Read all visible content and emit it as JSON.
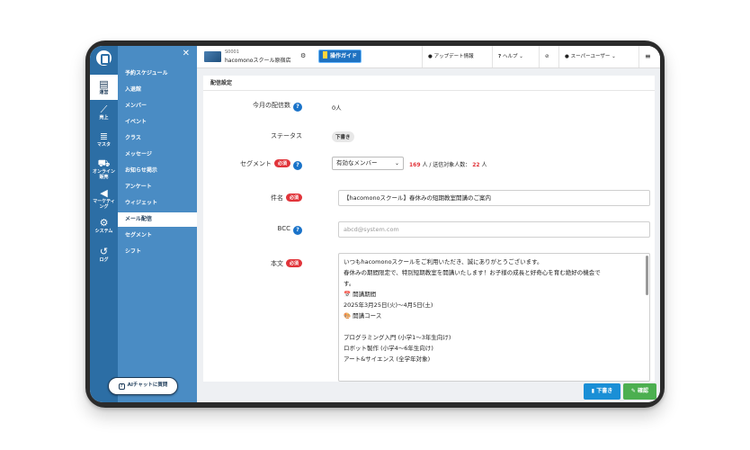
{
  "rail": [
    {
      "icon": "store-icon",
      "glyph": "▤",
      "label": "運営",
      "active": true
    },
    {
      "icon": "sales-chart-icon",
      "glyph": "⟋",
      "label": "売上",
      "active": false
    },
    {
      "icon": "database-icon",
      "glyph": "≣",
      "label": "マスタ",
      "active": false
    },
    {
      "icon": "cart-icon",
      "glyph": "⛟",
      "label": "オンライン販売",
      "active": false
    },
    {
      "icon": "megaphone-icon",
      "glyph": "◀",
      "label": "マーケティング",
      "active": false
    },
    {
      "icon": "gear-icon",
      "glyph": "⚙",
      "label": "システム",
      "active": false
    },
    {
      "icon": "history-icon",
      "glyph": "↺",
      "label": "ログ",
      "active": false
    }
  ],
  "menu": {
    "items": [
      {
        "label": "予約スケジュール",
        "active": false
      },
      {
        "label": "入退館",
        "active": false
      },
      {
        "label": "メンバー",
        "active": false
      },
      {
        "label": "イベント",
        "active": false
      },
      {
        "label": "クラス",
        "active": false
      },
      {
        "label": "メッセージ",
        "active": false
      },
      {
        "label": "お知らせ掲示",
        "active": false
      },
      {
        "label": "アンケート",
        "active": false
      },
      {
        "label": "ウィジェット",
        "active": false
      },
      {
        "label": "メール配信",
        "active": true
      },
      {
        "label": "セグメント",
        "active": false
      },
      {
        "label": "シフト",
        "active": false
      }
    ],
    "ai_button": "AIチャットに質問"
  },
  "topbar": {
    "store_code": "S0001",
    "store_name": "hacomonoスクール原宿店",
    "guide_label": "操作ガイド",
    "update_info": "アップデート情報",
    "help": "ヘルプ",
    "user": "スーパーユーザー"
  },
  "form": {
    "section_title": "配信設定",
    "monthly_count_label": "今月の配信数",
    "monthly_count_value": "0人",
    "status_label": "ステータス",
    "status_value": "下書き",
    "segment_label": "セグメント",
    "required": "必須",
    "segment_value": "有効なメンバー",
    "segment_count": "169",
    "segment_text": "人 / 送信対象人数：",
    "target_count": "22",
    "target_unit": "人",
    "subject_label": "件名",
    "subject_value": "【hacomonoスクール】春休みの短期教室開講のご案内",
    "bcc_label": "BCC",
    "bcc_placeholder": "abcd@system.com",
    "body_label": "本文",
    "body_lines": [
      "いつもhacomonoスクールをご利用いただき、誠にありがとうございます。",
      "春休みの期間限定で、特別短期教室を開講いたします！お子様の成長と好奇心を育む絶好の機会で",
      "す。",
      "📅 開講期間",
      "2025年3月25日(火)〜4月5日(土)",
      "🎨 開講コース",
      "",
      "プログラミング入門 (小学1〜3年生向け)",
      "ロボット製作 (小学4〜6年生向け)",
      "アート&サイエンス (全学年対象)"
    ]
  },
  "actions": {
    "draft": "下書き",
    "confirm": "確認"
  },
  "colors": {
    "rail": "#2c6ea5",
    "menu": "#4a8cc4",
    "required": "#e1343a",
    "draft_button": "#1a8fd6",
    "confirm_button": "#4caf50"
  }
}
